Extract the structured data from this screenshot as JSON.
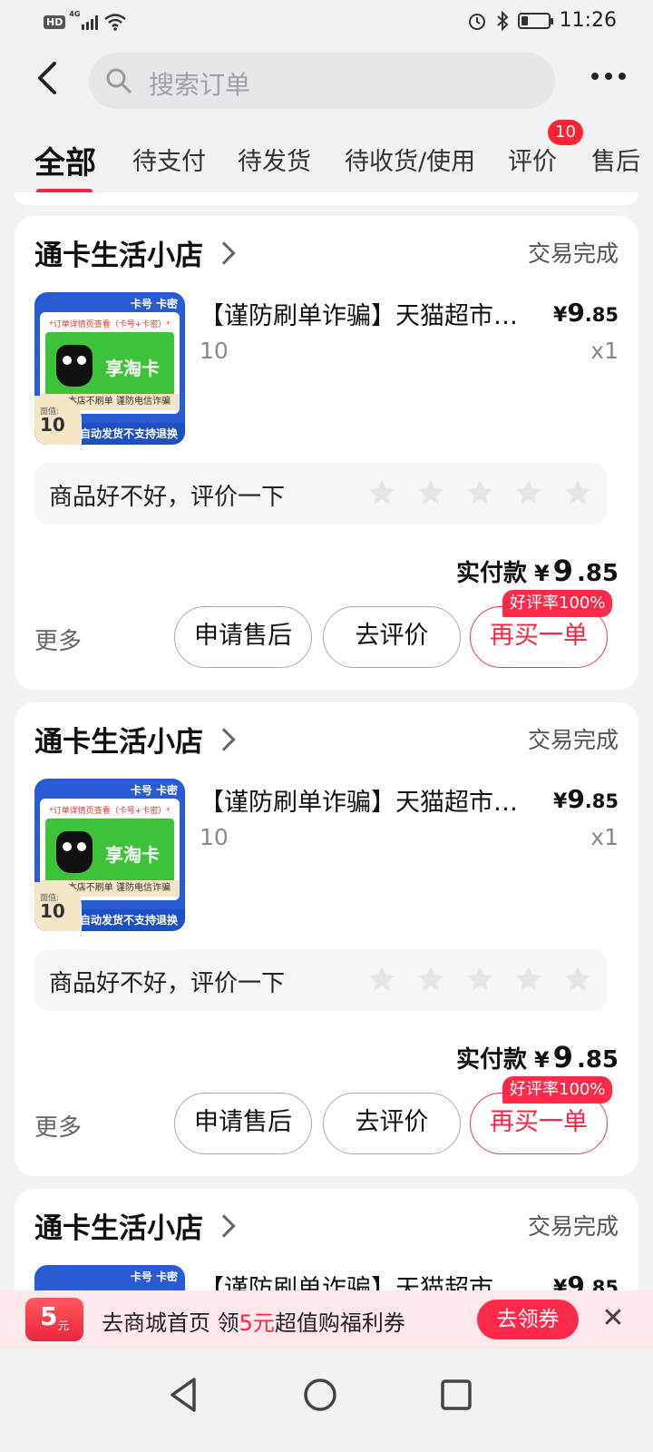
{
  "status_bar": {
    "hd": "HD",
    "network": "4G",
    "time": "11:26",
    "battery_level": 0.25
  },
  "header": {
    "back_icon": "back-arrow-icon",
    "search_placeholder": "搜索订单",
    "more_icon": "more-dots-icon"
  },
  "tabs": [
    {
      "label": "全部",
      "active": true
    },
    {
      "label": "待支付"
    },
    {
      "label": "待发货"
    },
    {
      "label": "待收货/使用"
    },
    {
      "label": "评价",
      "badge": "10"
    },
    {
      "label": "售后"
    }
  ],
  "orders": [
    {
      "shop": "通卡生活小店",
      "status": "交易完成",
      "title": "【谨防刷单诈骗】天猫超市电...",
      "sku": "10",
      "price_yen": "¥",
      "price_int": "9",
      "price_dec": ".85",
      "qty": "x1",
      "review_prompt": "商品好不好，评价一下",
      "paid_label": "实付款",
      "paid_yen": "¥",
      "paid_int": "9",
      "paid_dec": ".85",
      "more": "更多",
      "btn_after_sale": "申请售后",
      "btn_review": "去评价",
      "btn_rebuy": "再买一单",
      "rebuy_tag": "好评率100%",
      "thumb": {
        "tag": "卡号 卡密",
        "note": "*订单详情页查看（卡号+卡密）*",
        "card_name": "享淘卡",
        "strip": "本店不刷单 谨防电信诈骗",
        "bottom": "自动发货不支持退换",
        "face_label": "面值:",
        "face_value": "10"
      }
    },
    {
      "shop": "通卡生活小店",
      "status": "交易完成",
      "title": "【谨防刷单诈骗】天猫超市电...",
      "sku": "10",
      "price_yen": "¥",
      "price_int": "9",
      "price_dec": ".85",
      "qty": "x1",
      "review_prompt": "商品好不好，评价一下",
      "paid_label": "实付款",
      "paid_yen": "¥",
      "paid_int": "9",
      "paid_dec": ".85",
      "more": "更多",
      "btn_after_sale": "申请售后",
      "btn_review": "去评价",
      "btn_rebuy": "再买一单",
      "rebuy_tag": "好评率100%",
      "thumb": {
        "tag": "卡号 卡密",
        "note": "*订单详情页查看（卡号+卡密）*",
        "card_name": "享淘卡",
        "strip": "本店不刷单 谨防电信诈骗",
        "bottom": "自动发货不支持退换",
        "face_label": "面值:",
        "face_value": "10"
      }
    },
    {
      "shop": "通卡生活小店",
      "status": "交易完成",
      "title": "【谨防刷单诈骗】天猫超市电...",
      "price_yen": "¥",
      "price_int": "9",
      "price_dec": ".85",
      "thumb": {
        "tag": "卡号 卡密"
      }
    }
  ],
  "promo_banner": {
    "coupon_value": "5",
    "coupon_unit": "元",
    "text_before": "去商城首页 领",
    "text_highlight": "5元",
    "text_after": "超值购福利券",
    "button": "去领券",
    "close_icon": "close-icon"
  },
  "colors": {
    "accent": "#ff2244",
    "background": "#f2f2f4",
    "card": "#ffffff"
  }
}
